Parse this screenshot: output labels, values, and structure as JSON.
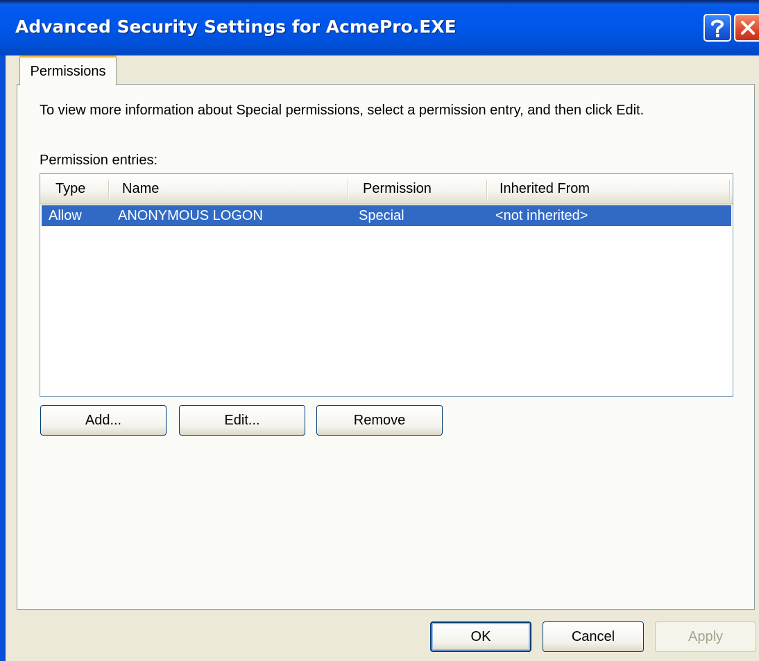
{
  "window": {
    "title": "Advanced Security Settings for AcmePro.EXE",
    "help_icon": "question-mark-icon",
    "close_icon": "close-icon"
  },
  "tabs": [
    {
      "label": "Permissions",
      "selected": true
    }
  ],
  "permissions": {
    "info_text": "To view more information about Special permissions, select a permission entry, and then click Edit.",
    "entries_label": "Permission entries:",
    "columns": [
      "Type",
      "Name",
      "Permission",
      "Inherited From"
    ],
    "rows": [
      {
        "type": "Allow",
        "name": "ANONYMOUS LOGON",
        "permission": "Special",
        "inherited_from": "<not inherited>",
        "selected": true
      }
    ],
    "buttons": {
      "add": "Add...",
      "edit": "Edit...",
      "remove": "Remove"
    }
  },
  "footer": {
    "ok": "OK",
    "cancel": "Cancel",
    "apply": "Apply"
  },
  "colors": {
    "titlebar": "#0058ee",
    "selection": "#316ac5",
    "tab_accent": "#f7b537",
    "dialog_bg": "#ece9d8"
  }
}
